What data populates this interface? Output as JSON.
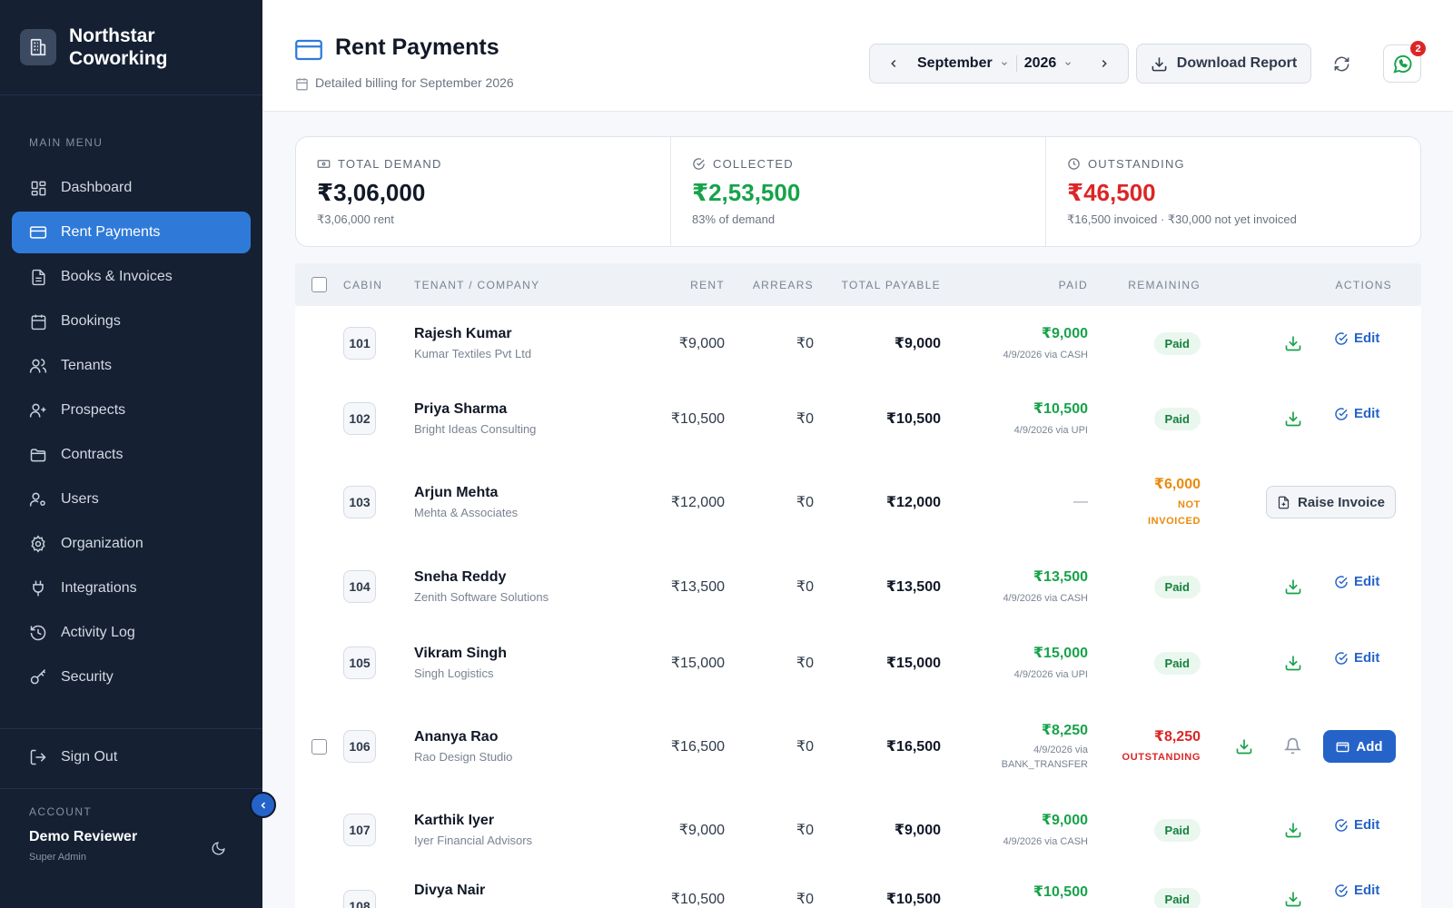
{
  "brand": {
    "name": "Northstar Coworking"
  },
  "sidebar": {
    "main_menu_heading": "MAIN MENU",
    "items": [
      {
        "label": "Dashboard",
        "icon": "dashboard-icon",
        "active": false
      },
      {
        "label": "Rent Payments",
        "icon": "credit-card-icon",
        "active": true
      },
      {
        "label": "Books & Invoices",
        "icon": "document-icon",
        "active": false
      },
      {
        "label": "Bookings",
        "icon": "calendar-icon",
        "active": false
      },
      {
        "label": "Tenants",
        "icon": "users-icon",
        "active": false
      },
      {
        "label": "Prospects",
        "icon": "user-plus-icon",
        "active": false
      },
      {
        "label": "Contracts",
        "icon": "folder-icon",
        "active": false
      },
      {
        "label": "Users",
        "icon": "user-cog-icon",
        "active": false
      },
      {
        "label": "Organization",
        "icon": "gear-icon",
        "active": false
      },
      {
        "label": "Integrations",
        "icon": "plug-icon",
        "active": false
      },
      {
        "label": "Activity Log",
        "icon": "history-icon",
        "active": false
      },
      {
        "label": "Security",
        "icon": "key-icon",
        "active": false
      }
    ],
    "sign_out": "Sign Out",
    "account_heading": "ACCOUNT",
    "account_name": "Demo Reviewer",
    "account_role": "Super Admin"
  },
  "header": {
    "title": "Rent Payments",
    "subtitle": "Detailed billing for September 2026",
    "month": "September",
    "year": "2026",
    "download_label": "Download Report",
    "whatsapp_badge": "2"
  },
  "stats": [
    {
      "label": "TOTAL DEMAND",
      "value": "₹3,06,000",
      "sub": "₹3,06,000 rent",
      "tone": "default"
    },
    {
      "label": "COLLECTED",
      "value": "₹2,53,500",
      "sub": "83% of demand",
      "tone": "green"
    },
    {
      "label": "OUTSTANDING",
      "value": "₹46,500",
      "sub": "₹16,500 invoiced · ₹30,000 not yet invoiced",
      "tone": "red"
    }
  ],
  "table": {
    "columns": [
      "CABIN",
      "TENANT / COMPANY",
      "RENT",
      "ARREARS",
      "TOTAL PAYABLE",
      "PAID",
      "REMAINING",
      "ACTIONS"
    ],
    "rows": [
      {
        "cabin": "101",
        "name": "Rajesh Kumar",
        "company": "Kumar Textiles Pvt Ltd",
        "rent": "₹9,000",
        "arrears": "₹0",
        "total": "₹9,000",
        "paid": "₹9,000",
        "paid_meta": "4/9/2026 via CASH",
        "status": "Paid"
      },
      {
        "cabin": "102",
        "name": "Priya Sharma",
        "company": "Bright Ideas Consulting",
        "rent": "₹10,500",
        "arrears": "₹0",
        "total": "₹10,500",
        "paid": "₹10,500",
        "paid_meta": "4/9/2026 via UPI",
        "status": "Paid"
      },
      {
        "cabin": "103",
        "name": "Arjun Mehta",
        "company": "Mehta & Associates",
        "rent": "₹12,000",
        "arrears": "₹0",
        "total": "₹12,000",
        "paid": "—",
        "paid_meta": "",
        "remaining": "₹6,000",
        "remaining_tag": "NOT INVOICED",
        "action": "Raise Invoice"
      },
      {
        "cabin": "104",
        "name": "Sneha Reddy",
        "company": "Zenith Software Solutions",
        "rent": "₹13,500",
        "arrears": "₹0",
        "total": "₹13,500",
        "paid": "₹13,500",
        "paid_meta": "4/9/2026 via CASH",
        "status": "Paid"
      },
      {
        "cabin": "105",
        "name": "Vikram Singh",
        "company": "Singh Logistics",
        "rent": "₹15,000",
        "arrears": "₹0",
        "total": "₹15,000",
        "paid": "₹15,000",
        "paid_meta": "4/9/2026 via UPI",
        "status": "Paid"
      },
      {
        "cabin": "106",
        "name": "Ananya Rao",
        "company": "Rao Design Studio",
        "rent": "₹16,500",
        "arrears": "₹0",
        "total": "₹16,500",
        "paid": "₹8,250",
        "paid_meta_1": "4/9/2026 via",
        "paid_meta_2": "BANK_TRANSFER",
        "remaining": "₹8,250",
        "remaining_tag": "OUTSTANDING",
        "action": "Add"
      },
      {
        "cabin": "107",
        "name": "Karthik Iyer",
        "company": "Iyer Financial Advisors",
        "rent": "₹9,000",
        "arrears": "₹0",
        "total": "₹9,000",
        "paid": "₹9,000",
        "paid_meta": "4/9/2026 via CASH",
        "status": "Paid"
      },
      {
        "cabin": "108",
        "name": "Divya Nair",
        "company": "",
        "rent": "₹10,500",
        "arrears": "₹0",
        "total": "₹10,500",
        "paid": "₹10,500",
        "paid_meta": "",
        "status": "Paid"
      }
    ],
    "edit_label": "Edit"
  },
  "colors": {
    "sidebar_bg": "#152033",
    "accent": "#2f7ad8",
    "paid_green": "#16a34a",
    "outstanding_red": "#dc2626",
    "not_invoiced_orange": "#ea8a0c"
  }
}
